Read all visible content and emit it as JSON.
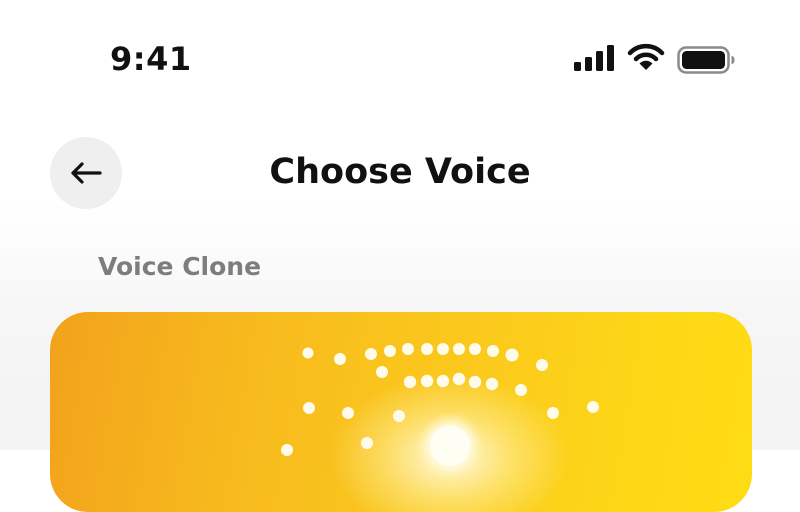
{
  "status_bar": {
    "time": "9:41",
    "signal_icon": "cellular-signal-icon",
    "wifi_icon": "wifi-icon",
    "battery_icon": "battery-full-icon"
  },
  "header": {
    "back_icon": "arrow-left-icon",
    "title": "Choose Voice"
  },
  "section": {
    "label": "Voice Clone"
  },
  "card": {
    "accent_from": "#f2a21c",
    "accent_to": "#fedc14",
    "decoration_icon": "sound-wave-dots-icon"
  }
}
